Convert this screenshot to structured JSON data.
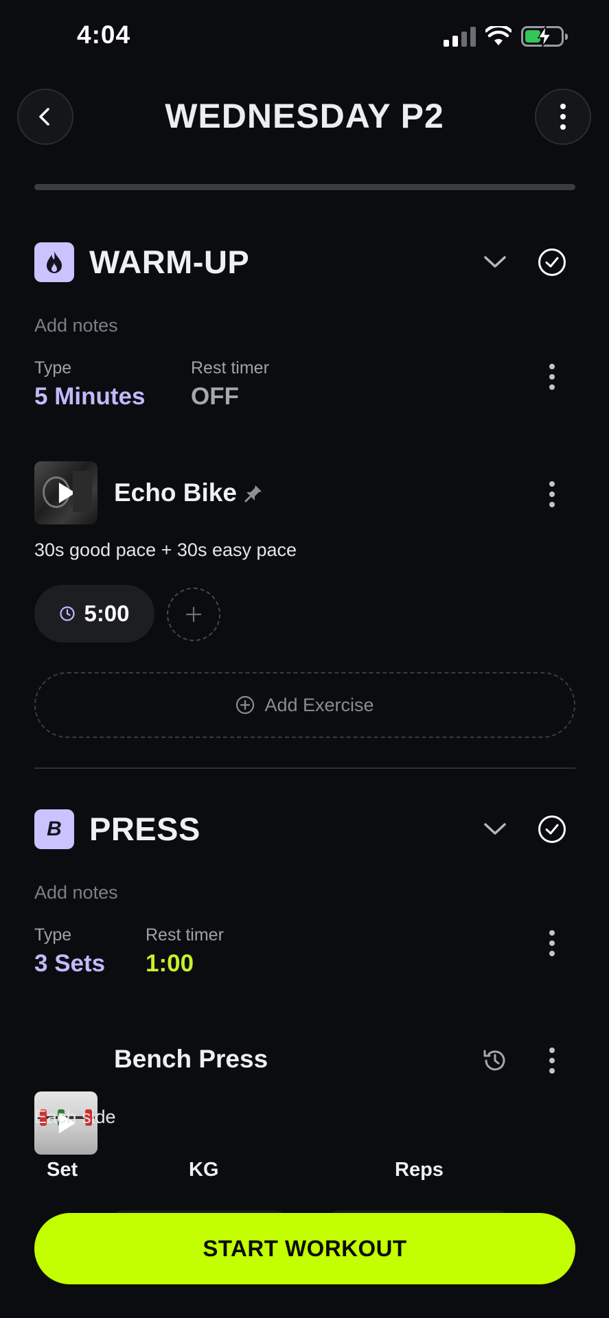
{
  "status_bar": {
    "time": "4:04"
  },
  "header": {
    "title": "WEDNESDAY P2"
  },
  "sections": [
    {
      "badge": "",
      "title": "WARM-UP",
      "notes_placeholder": "Add notes",
      "type_label": "Type",
      "type_value": "5 Minutes",
      "rest_label": "Rest timer",
      "rest_value": "OFF",
      "exercise": {
        "name": "Echo Bike",
        "description": "30s good pace + 30s easy pace",
        "time": "5:00"
      },
      "add_exercise_label": "Add Exercise"
    },
    {
      "badge": "B",
      "title": "PRESS",
      "notes_placeholder": "Add notes",
      "type_label": "Type",
      "type_value": "3 Sets",
      "rest_label": "Rest timer",
      "rest_value": "1:00",
      "exercise": {
        "name": "Bench Press",
        "description": "Each side"
      },
      "columns": [
        "Set",
        "KG",
        "Reps"
      ]
    }
  ],
  "start_button": "START WORKOUT",
  "colors": {
    "background": "#0b0c0f",
    "accent_lime": "#c3ff00",
    "accent_purple": "#c3b9ff"
  }
}
